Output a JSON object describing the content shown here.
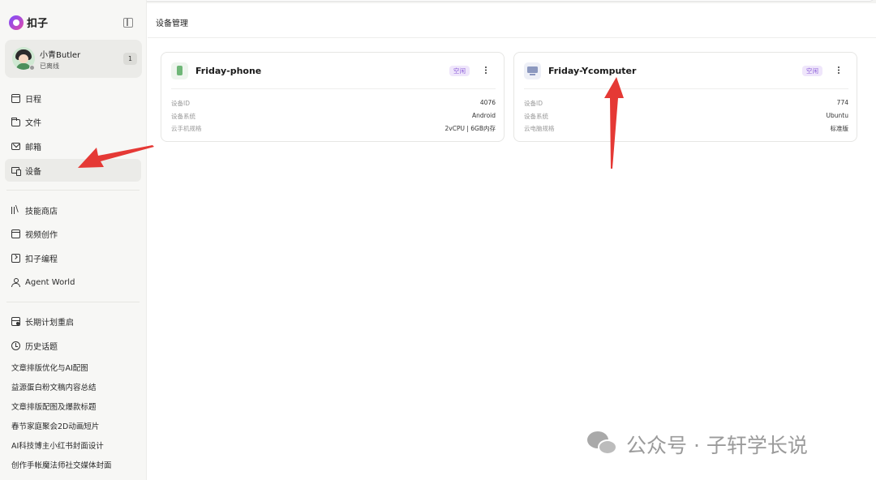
{
  "app": {
    "brand_name": "扣子"
  },
  "user": {
    "name": "小青Butler",
    "status": "已离线",
    "badge": "1"
  },
  "nav": {
    "primary": [
      {
        "label": "日程",
        "icon": "calendar-icon"
      },
      {
        "label": "文件",
        "icon": "folder-icon"
      },
      {
        "label": "邮箱",
        "icon": "mail-icon"
      },
      {
        "label": "设备",
        "icon": "device-icon",
        "active": true
      }
    ],
    "secondary": [
      {
        "label": "技能商店",
        "icon": "library-icon"
      },
      {
        "label": "视频创作",
        "icon": "video-icon"
      },
      {
        "label": "扣子编程",
        "icon": "code-icon"
      },
      {
        "label": "Agent World",
        "icon": "person-icon"
      }
    ],
    "tertiary": [
      {
        "label": "长期计划重启",
        "icon": "plan-icon"
      },
      {
        "label": "历史话题",
        "icon": "history-icon"
      }
    ]
  },
  "history_topics": [
    "文章排版优化与AI配图",
    "益源蛋白粉文稿内容总结",
    "文章排版配图及爆款标题",
    "春节家庭聚会2D动画短片",
    "AI科技博主小红书封面设计",
    "创作手帐魔法师社交媒体封面"
  ],
  "main": {
    "title": "设备管理",
    "devices": [
      {
        "name": "Friday-phone",
        "icon": "phone-icon",
        "status": "空闲",
        "rows": [
          {
            "key": "设备ID",
            "value": "4076"
          },
          {
            "key": "设备系统",
            "value": "Android"
          },
          {
            "key": "云手机规格",
            "value": "2vCPU | 6GB内存"
          }
        ]
      },
      {
        "name": "Friday-Ycomputer",
        "icon": "computer-icon",
        "status": "空闲",
        "rows": [
          {
            "key": "设备ID",
            "value": "774"
          },
          {
            "key": "设备系统",
            "value": "Ubuntu"
          },
          {
            "key": "云电脑规格",
            "value": "标准版"
          }
        ]
      }
    ]
  },
  "watermark": {
    "text": "公众号 · 子轩学长说"
  },
  "colors": {
    "annotation_arrow": "#e53935",
    "idle_badge_bg": "#efe6fb",
    "idle_badge_text": "#8c5ed8",
    "sidebar_bg": "#f7f7f5"
  }
}
